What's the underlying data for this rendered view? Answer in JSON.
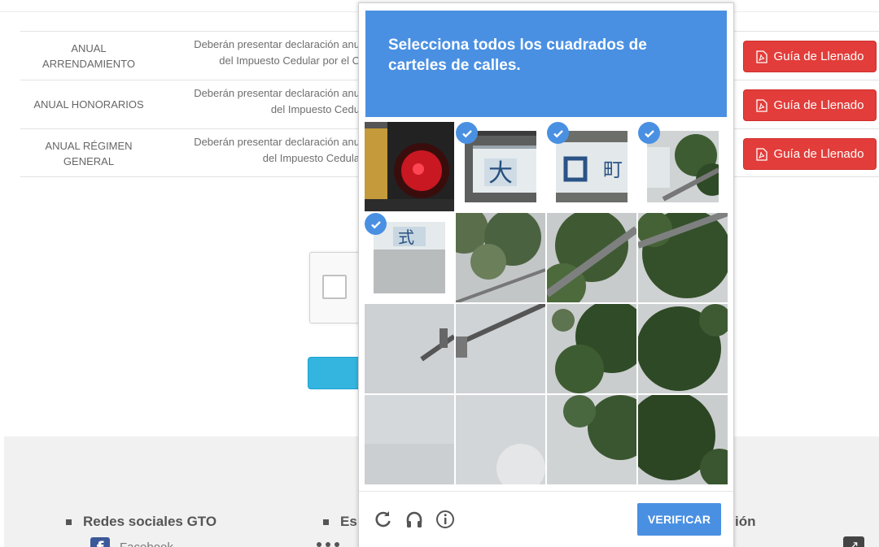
{
  "table": {
    "rows": [
      {
        "type": "ANUAL ARRENDAMIENTO",
        "desc_line1": "Deberán presentar declaración anu",
        "desc_line2": "del Impuesto Cedular por el C",
        "button": "Guía de Llenado"
      },
      {
        "type": "ANUAL HONORARIOS",
        "desc_line1": "Deberán presentar declaración anu",
        "desc_line2": "del Impuesto Cedu",
        "button": "Guía de Llenado"
      },
      {
        "type": "ANUAL RÉGIMEN GENERAL",
        "desc_line1": "Deberán presentar declaración anu",
        "desc_line2": "del Impuesto Cedula",
        "button": "Guía de Llenado"
      }
    ]
  },
  "footer": {
    "col1_heading": "Redes sociales GTO",
    "col2_heading": "Es",
    "col3_heading": "ión",
    "facebook_label": "Facebook"
  },
  "captcha": {
    "title": "Selecciona todos los cuadrados de carteles de calles.",
    "verify_label": "VERIFICAR",
    "icons": [
      "reload-icon",
      "audio-icon",
      "info-icon"
    ],
    "tiles_selected": [
      1,
      2,
      3,
      4
    ],
    "accent_color": "#4a90e2"
  },
  "colors": {
    "guia_button": "#e23d3a",
    "submit_button": "#33b5df"
  }
}
